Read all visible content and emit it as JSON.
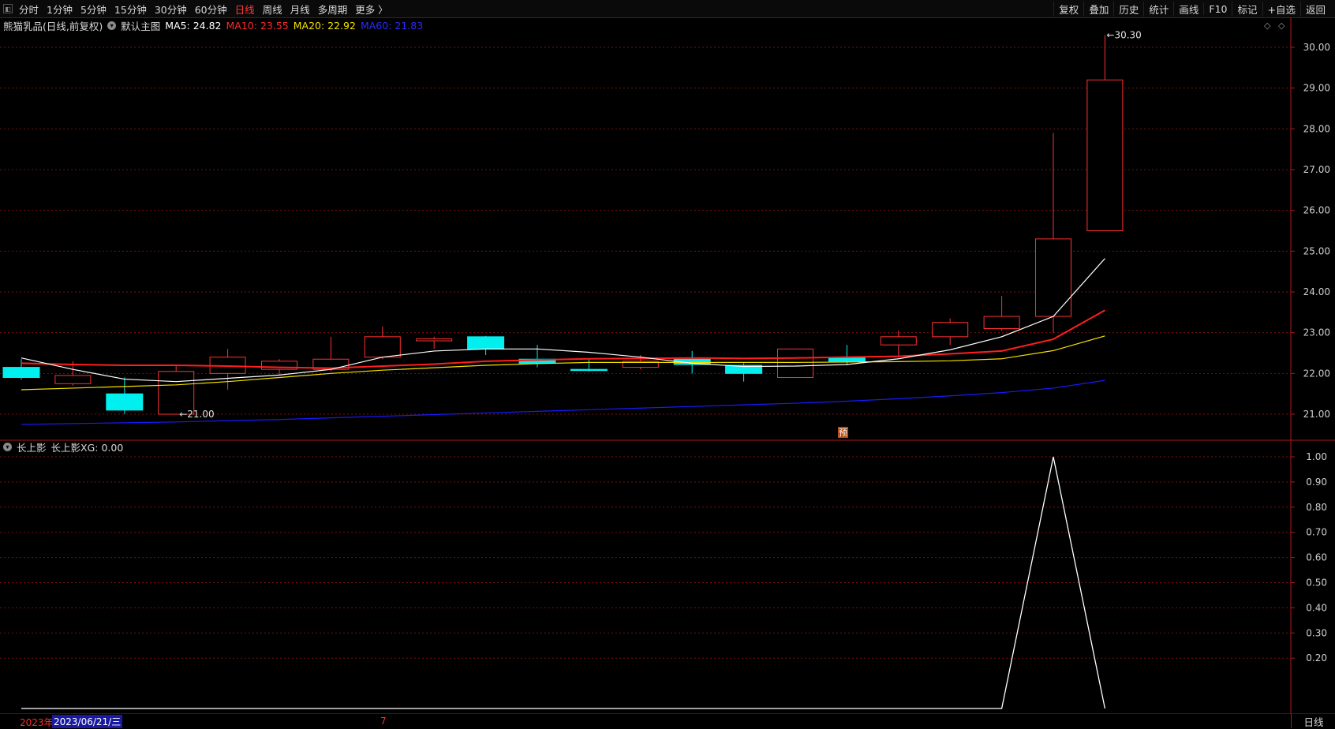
{
  "toolbar": {
    "periods": [
      "分时",
      "1分钟",
      "5分钟",
      "15分钟",
      "30分钟",
      "60分钟",
      "日线",
      "周线",
      "月线",
      "多周期",
      "更多 〉"
    ],
    "active_period": "日线",
    "right_items": [
      "复权",
      "叠加",
      "历史",
      "统计",
      "画线",
      "F10",
      "标记",
      "+自选",
      "返回"
    ]
  },
  "main_header": {
    "stock": "熊猫乳品(日线,前复权)",
    "template": "默认主图",
    "ma5": "MA5: 24.82",
    "ma10": "MA10: 23.55",
    "ma20": "MA20: 22.92",
    "ma60": "MA60: 21.83"
  },
  "sub_header": {
    "indicator": "长上影",
    "value": "长上影XG: 0.00"
  },
  "colors": {
    "up": "#ff3030",
    "down": "#00f0f0",
    "ma5": "#ffffff",
    "ma10": "#ff1e1e",
    "ma20": "#f5e000",
    "ma60": "#1a1aff",
    "grid": "#7a0f0f"
  },
  "chart_data": [
    {
      "type": "candlestick",
      "ylim": [
        20.7,
        30.6
      ],
      "y_ticks": [
        "30.00",
        "29.00",
        "28.00",
        "27.00",
        "26.00",
        "25.00",
        "24.00",
        "23.00",
        "22.00",
        "21.00"
      ],
      "candles": [
        {
          "o": 22.15,
          "h": 22.35,
          "l": 21.85,
          "c": 21.9
        },
        {
          "o": 21.75,
          "h": 22.3,
          "l": 21.7,
          "c": 21.95
        },
        {
          "o": 21.5,
          "h": 21.9,
          "l": 21.0,
          "c": 21.1
        },
        {
          "o": 21.0,
          "h": 22.2,
          "l": 21.0,
          "c": 22.05
        },
        {
          "o": 22.0,
          "h": 22.6,
          "l": 21.6,
          "c": 22.4
        },
        {
          "o": 22.1,
          "h": 22.35,
          "l": 21.95,
          "c": 22.3
        },
        {
          "o": 22.1,
          "h": 22.9,
          "l": 22.05,
          "c": 22.35
        },
        {
          "o": 22.4,
          "h": 23.15,
          "l": 22.35,
          "c": 22.9
        },
        {
          "o": 22.8,
          "h": 22.9,
          "l": 22.6,
          "c": 22.85
        },
        {
          "o": 22.9,
          "h": 22.92,
          "l": 22.45,
          "c": 22.6
        },
        {
          "o": 22.35,
          "h": 22.7,
          "l": 22.15,
          "c": 22.25
        },
        {
          "o": 22.1,
          "h": 22.35,
          "l": 22.05,
          "c": 22.08
        },
        {
          "o": 22.15,
          "h": 22.45,
          "l": 22.1,
          "c": 22.3
        },
        {
          "o": 22.35,
          "h": 22.55,
          "l": 22.0,
          "c": 22.22
        },
        {
          "o": 22.2,
          "h": 22.25,
          "l": 21.8,
          "c": 22.0
        },
        {
          "o": 21.9,
          "h": 22.6,
          "l": 21.9,
          "c": 22.6
        },
        {
          "o": 22.4,
          "h": 22.7,
          "l": 22.2,
          "c": 22.3
        },
        {
          "o": 22.7,
          "h": 23.05,
          "l": 22.4,
          "c": 22.9
        },
        {
          "o": 22.9,
          "h": 23.35,
          "l": 22.7,
          "c": 23.25
        },
        {
          "o": 23.1,
          "h": 23.9,
          "l": 23.05,
          "c": 23.4
        },
        {
          "o": 23.4,
          "h": 27.9,
          "l": 23.0,
          "c": 25.3
        },
        {
          "o": 25.5,
          "h": 30.3,
          "l": 25.5,
          "c": 29.2
        }
      ],
      "ma5": [
        22.38,
        22.1,
        21.86,
        21.8,
        21.88,
        21.96,
        22.1,
        22.4,
        22.55,
        22.6,
        22.6,
        22.52,
        22.4,
        22.25,
        22.17,
        22.18,
        22.22,
        22.36,
        22.58,
        22.9,
        23.4,
        24.82
      ],
      "ma10": [
        22.25,
        22.22,
        22.2,
        22.2,
        22.18,
        22.15,
        22.13,
        22.18,
        22.23,
        22.3,
        22.33,
        22.36,
        22.37,
        22.38,
        22.37,
        22.38,
        22.4,
        22.42,
        22.48,
        22.55,
        22.84,
        23.55
      ],
      "ma20": [
        21.6,
        21.64,
        21.68,
        21.72,
        21.8,
        21.9,
        22.0,
        22.08,
        22.14,
        22.2,
        22.24,
        22.27,
        22.27,
        22.27,
        22.27,
        22.27,
        22.28,
        22.29,
        22.31,
        22.36,
        22.56,
        22.92
      ],
      "ma60": [
        20.75,
        20.77,
        20.79,
        20.81,
        20.84,
        20.87,
        20.91,
        20.95,
        20.99,
        21.03,
        21.07,
        21.11,
        21.15,
        21.19,
        21.23,
        21.27,
        21.32,
        21.38,
        21.45,
        21.53,
        21.64,
        21.83
      ],
      "annotations": {
        "high_label": "30.30",
        "low_label": "21.00",
        "marker": "预"
      }
    },
    {
      "type": "line",
      "name": "长上影XG",
      "ylim": [
        0,
        1.05
      ],
      "y_ticks": [
        "1.00",
        "0.90",
        "0.80",
        "0.70",
        "0.60",
        "0.50",
        "0.40",
        "0.30",
        "0.20"
      ],
      "values": [
        0,
        0,
        0,
        0,
        0,
        0,
        0,
        0,
        0,
        0,
        0,
        0,
        0,
        0,
        0,
        0,
        0,
        0,
        0,
        0,
        1,
        0
      ]
    }
  ],
  "bottom": {
    "year": "2023年",
    "date": "2023/06/21/三",
    "month": "7",
    "period": "日线"
  }
}
